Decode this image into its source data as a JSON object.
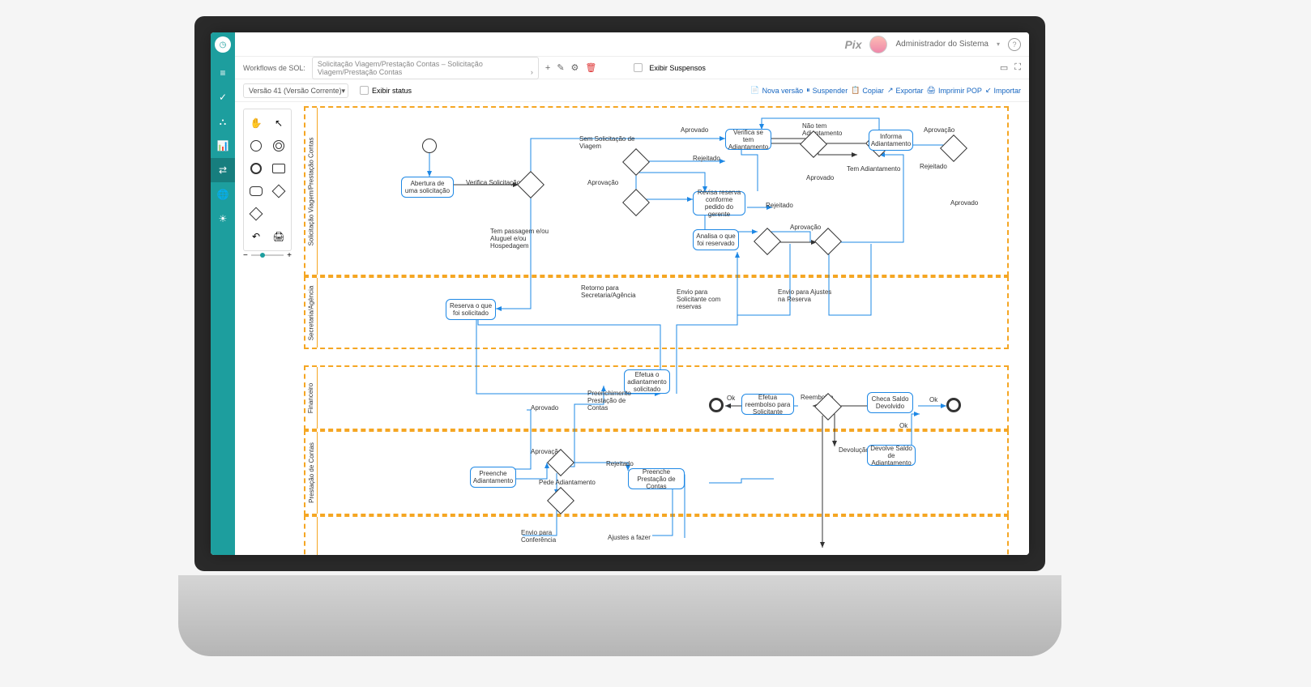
{
  "topbar": {
    "brand": "Pix",
    "user_name": "Administrador do Sistema"
  },
  "toolbar1": {
    "label": "Workflows de SOL:",
    "selected_workflow": "Solicitação Viagem/Prestação Contas – Solicitação Viagem/Prestação Contas",
    "show_suspended": "Exibir Suspensos"
  },
  "toolbar2": {
    "version": "Versão 41 (Versão Corrente)",
    "show_status": "Exibir status",
    "actions": {
      "nova_versao": "Nova versão",
      "suspender": "Suspender",
      "copiar": "Copiar",
      "exportar": "Exportar",
      "imprimir": "Imprimir POP",
      "importar": "Importar"
    }
  },
  "lanes": {
    "l1": "Solicitação Viagem/Prestação Contas",
    "l2": "Secretaria/Agência",
    "l3": "Financeiro",
    "l4": "Prestação de Contas"
  },
  "tasks": {
    "abertura": "Abertura de uma solicitação",
    "verifica": "Verifica Solicitação",
    "verifica_adiant": "Verifica se tem Adiantamento",
    "informa_adiant": "Informa Adiantamento",
    "revisa": "Revisa reserva conforme pedido do gerente",
    "analisa": "Analisa o que foi reservado",
    "reserva": "Reserva o que foi solicitado",
    "efetua_adiant": "Efetua o adiantamento solicitado",
    "efetua_reemb": "Efetua reembolso para Solicitante",
    "checa": "Checa Saldo Devolvido",
    "devolve": "Devolve Saldo de Adiantamento",
    "preenche_adiant": "Preenche Adiantamento",
    "preenche_prest": "Preenche Prestação de Contas"
  },
  "labels": {
    "sem_solic": "Sem Solicitação de Viagem",
    "tem_passagem": "Tem passagem e/ou Aluguel e/ou Hospedagem",
    "aprovacao": "Aprovação",
    "aprovado": "Aprovado",
    "rejeitado": "Rejeitado",
    "nao_tem_adiant": "Não tem Adiantamento",
    "tem_adiant": "Tem Adiantamento",
    "retorno": "Retorno para Secretaria/Agência",
    "envio_solic": "Envio para Solicitante com reservas",
    "envio_ajustes": "Envio para Ajustes na Reserva",
    "preenchimento": "Preenchimento Prestação de Contas",
    "ok": "Ok",
    "reembolso": "Reembolso",
    "devolucao": "Devolução",
    "pede_adiant": "Pede Adiantamento",
    "envio_conf": "Envio para Conferência",
    "ajustes_fazer": "Ajustes a fazer"
  }
}
